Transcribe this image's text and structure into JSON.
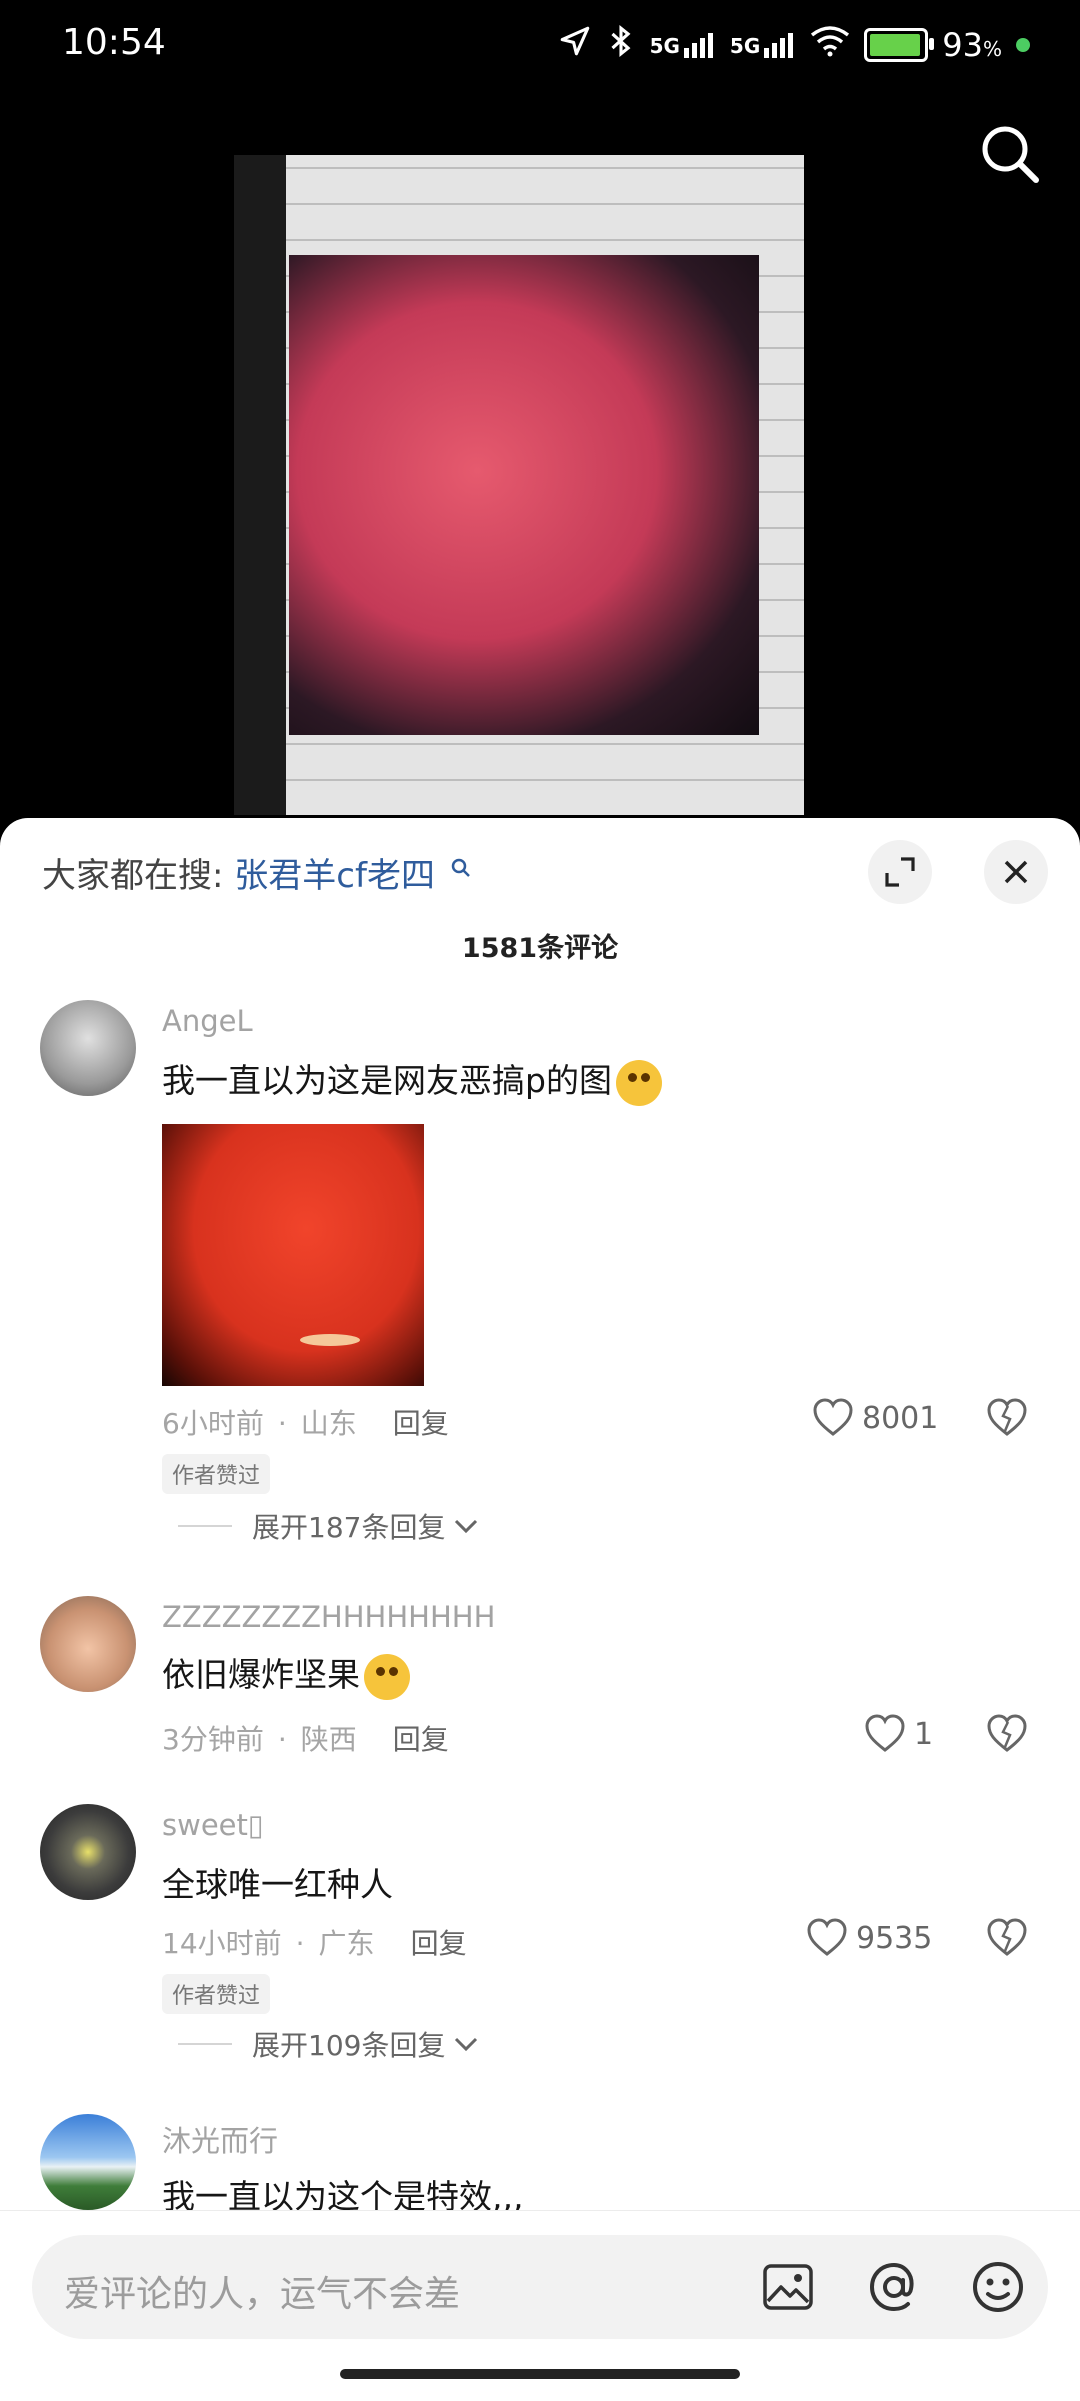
{
  "status_bar": {
    "time": "10:54",
    "battery_percent": "93",
    "battery_symbol": "%",
    "signal_label_1": "5G",
    "signal_label_2": "5G",
    "battery_level": 0.93
  },
  "video": {
    "search_icon": "search-icon"
  },
  "sheet": {
    "hot_search_prefix": "大家都在搜:",
    "hot_search_keyword": "张君羊cf老四",
    "comment_count": "1581条评论"
  },
  "comments": [
    {
      "name": "AngeL",
      "text": "我一直以为这是网友恶搞p的图",
      "time": "6小时前",
      "location": "山东",
      "reply": "回复",
      "likes": "8001",
      "badge": "作者赞过",
      "expand": "展开187条回复"
    },
    {
      "name": "ZZZZZZZZHHHHHHHH",
      "text": "依旧爆炸坚果",
      "time": "3分钟前",
      "location": "陕西",
      "reply": "回复",
      "likes": "1"
    },
    {
      "name": "sweet▯",
      "text": "全球唯一红种人",
      "time": "14小时前",
      "location": "广东",
      "reply": "回复",
      "likes": "9535",
      "badge": "作者赞过",
      "expand": "展开109条回复"
    },
    {
      "name": "沐光而行",
      "text": "我一直以为这个是特效,,,"
    }
  ],
  "input": {
    "placeholder": "爱评论的人，运气不会差"
  },
  "meta_separator": "·"
}
